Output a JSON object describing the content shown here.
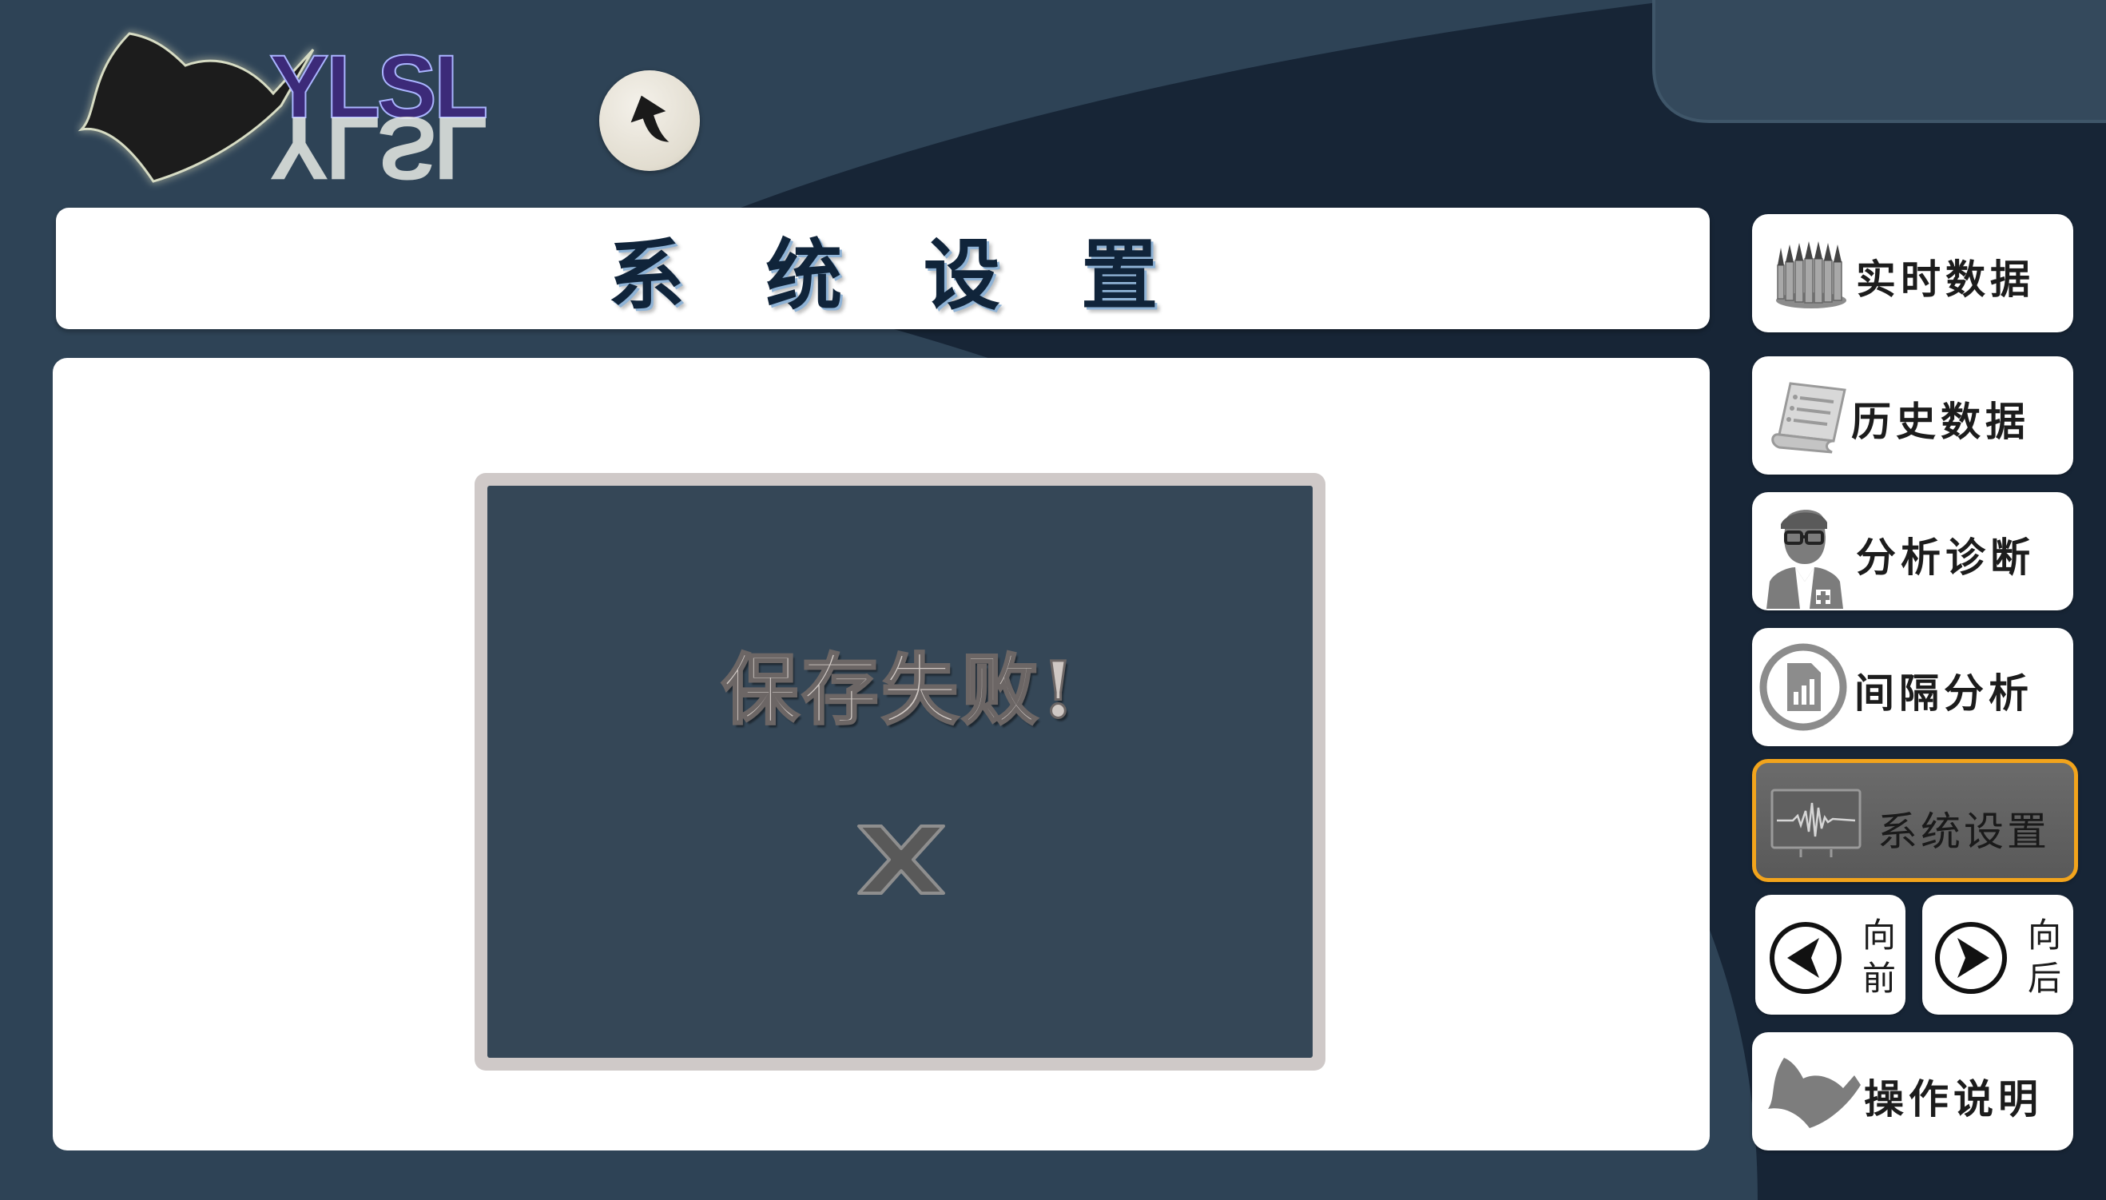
{
  "logo": {
    "text": "YLSL",
    "mirrored_text": "YLSL"
  },
  "header": {
    "up_icon": "up-arrow-icon"
  },
  "title_bar": {
    "title": "系 统 设 置"
  },
  "dialog": {
    "message": "保存失败!",
    "close_icon": "close-x-icon"
  },
  "sidebar": {
    "items": [
      {
        "label": "实时数据",
        "icon": "pencils-icon"
      },
      {
        "label": "历史数据",
        "icon": "document-scroll-icon"
      },
      {
        "label": "分析诊断",
        "icon": "doctor-icon"
      },
      {
        "label": "间隔分析",
        "icon": "chart-report-icon"
      },
      {
        "label": "系统设置",
        "icon": "waveform-monitor-icon",
        "active": true
      }
    ],
    "nav": {
      "prev_top": "向",
      "prev_bottom": "前",
      "next_top": "向",
      "next_bottom": "后"
    },
    "help": {
      "label": "操作说明",
      "icon": "bird-logo-icon"
    }
  },
  "colors": {
    "accent_active": "#f2a41c",
    "background": "#2d4254",
    "dialog_bg": "#354757"
  }
}
